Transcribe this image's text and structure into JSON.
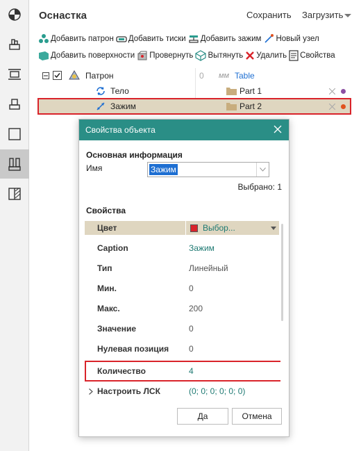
{
  "app": {
    "title": "Оснастка",
    "save_label": "Сохранить",
    "load_label": "Загрузить"
  },
  "left_toolbar": {
    "items": [
      {
        "name": "view-icon"
      },
      {
        "name": "assembly-icon"
      },
      {
        "name": "align-icon"
      },
      {
        "name": "stamp-icon"
      },
      {
        "name": "frame-icon"
      },
      {
        "name": "fixture-icon",
        "active": true
      },
      {
        "name": "section-icon"
      }
    ]
  },
  "actions": {
    "row1": [
      {
        "label": "Добавить патрон",
        "icon": "chuck-icon"
      },
      {
        "label": "Добавить тиски",
        "icon": "vise-icon"
      },
      {
        "label": "Добавить зажим",
        "icon": "clamp-icon"
      },
      {
        "label": "Новый узел",
        "icon": "node-icon"
      }
    ],
    "row2": [
      {
        "label": "Добавить поверхности",
        "icon": "surface-icon"
      },
      {
        "label": "Провернуть",
        "icon": "rotate-icon"
      },
      {
        "label": "Вытянуть",
        "icon": "extrude-icon"
      },
      {
        "label": "Удалить",
        "icon": "delete-icon"
      },
      {
        "label": "Свойства",
        "icon": "properties-icon"
      }
    ]
  },
  "tree": {
    "rows": [
      {
        "label": "Патрон",
        "value": "0",
        "unit": "мм",
        "extra": "Table"
      },
      {
        "label": "Тело",
        "part": "Part 1",
        "dot_color": "#8b4fa3"
      },
      {
        "label": "Зажим",
        "part": "Part 2",
        "dot_color": "#e0521f"
      }
    ]
  },
  "dialog": {
    "title": "Свойства объекта",
    "main_section": "Основная информация",
    "name_label": "Имя",
    "name_value": "Зажим",
    "selected_count": "Выбрано: 1",
    "props_section": "Свойства",
    "color_label": "Цвет",
    "color_value": "Выбор...",
    "color_swatch": "#d9232a",
    "properties": [
      {
        "name": "Caption",
        "value": "Зажим"
      },
      {
        "name": "Тип",
        "value": "Линейный"
      },
      {
        "name": "Мин.",
        "value": "0"
      },
      {
        "name": "Макс.",
        "value": "200"
      },
      {
        "name": "Значение",
        "value": "0"
      },
      {
        "name": "Нулевая позиция",
        "value": "0"
      },
      {
        "name": "Количество",
        "value": "4"
      }
    ],
    "lcs_label": "Настроить ЛСК",
    "lcs_value": "(0; 0; 0; 0; 0; 0)",
    "ok_label": "Да",
    "cancel_label": "Отмена"
  },
  "colors": {
    "accent": "#2a8e86",
    "highlight": "#d9232a",
    "selection_bg": "#dfd6c0"
  }
}
